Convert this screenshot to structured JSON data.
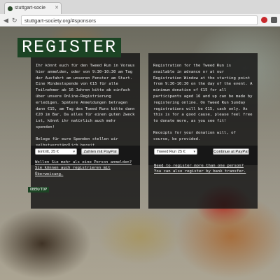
{
  "browser": {
    "tab_title": "stuttgart-socie",
    "url": "stuttgart-society.org/#sponsors"
  },
  "page": {
    "heading": "REGISTER",
    "left_text": [
      "Ihr könnt euch für den Tweed Run in Voraus hier anmelden, oder von 9:30-10:30 am Tag der Ausfahrt am unseren Fenster am Start. Eine Mindestspende von €15 für alle Teilnehmer ab 16 Jahren bitte ab einfach über unsere Online-Registrierung erledigen. Spätere Anmeldungen betragen dann €15, am Tag des Tweed Runs bitte dann €20 im Bar. Da alles für einen guten Zweck ist, könnt ihr natürlich auch mehr spenden!",
      "Belege für eure Spenden stellen wir selbstverständlich bereit."
    ],
    "right_text": [
      "Registration for the Tweed Run is available in advance or at our Registration Window at the starting point from 9:30-10:30 on the day of the event. A minimum donation of €15 for all participants aged 16 and up can be made by registering online. On Tweed Run Sunday registrations will be €15, cash only. As this is for a good cause, please feel free to donate more, as you see fit!",
      "Receipts for your donation will, of course, be provided."
    ],
    "left_form": {
      "select_value": "Eintritt, 25 €",
      "button_label": "Zahlen mit PayPal",
      "link_lines": [
        "Wollen Sie mehr als eine Person anmelden?",
        "Sie können auch registrieren mit",
        "Überweisung."
      ]
    },
    "right_form": {
      "select_value": "Tweed Run 25 €",
      "button_label": "Continue at PayPal",
      "link_lines": [
        "Need to register more than one person?",
        "You can also register by bank transfer."
      ]
    },
    "tag": "OBEN/TOP"
  }
}
